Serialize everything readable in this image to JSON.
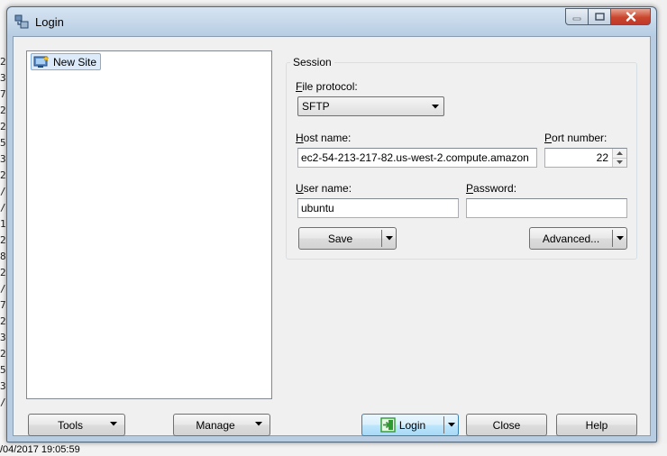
{
  "background": {
    "timestamp": "/04/2017  19:05:59",
    "edge_digits": [
      "2",
      "3",
      "7",
      "2",
      "2",
      "5",
      "3",
      "2",
      "/",
      "/",
      "1",
      "2",
      "8",
      "2",
      "/",
      "7",
      "2",
      "3",
      "2",
      "5",
      "3",
      "/"
    ]
  },
  "window": {
    "title": "Login",
    "icons": {
      "app": "winscp-icon",
      "minimize": "minimize-icon",
      "maximize": "maximize-icon",
      "close": "close-icon"
    }
  },
  "site_tree": {
    "items": [
      {
        "label": "New Site",
        "icon": "new-site-monitor-icon"
      }
    ]
  },
  "session": {
    "group_label": "Session",
    "file_protocol": {
      "label_prefix": "F",
      "label_rest": "ile protocol:",
      "value": "SFTP"
    },
    "host_name": {
      "label_prefix": "H",
      "label_rest": "ost name:",
      "value": "ec2-54-213-217-82.us-west-2.compute.amazon"
    },
    "port_number": {
      "label_prefix": "P",
      "label_rest": "ort number:",
      "value": "22"
    },
    "user_name": {
      "label_prefix": "U",
      "label_rest": "ser name:",
      "value": "ubuntu"
    },
    "password": {
      "label_prefix": "P",
      "label_rest": "assword:",
      "value": ""
    },
    "save_button": "Save",
    "advanced_button": "Advanced..."
  },
  "bottom_buttons": {
    "tools": "Tools",
    "manage": "Manage",
    "login": "Login",
    "close": "Close",
    "help": "Help"
  },
  "colors": {
    "window_frame": "#b8cde2",
    "client_bg": "#f0f0f0",
    "selection_bg": "#dceaf9",
    "close_red": "#c9462c",
    "login_green": "#2e9b2e"
  }
}
